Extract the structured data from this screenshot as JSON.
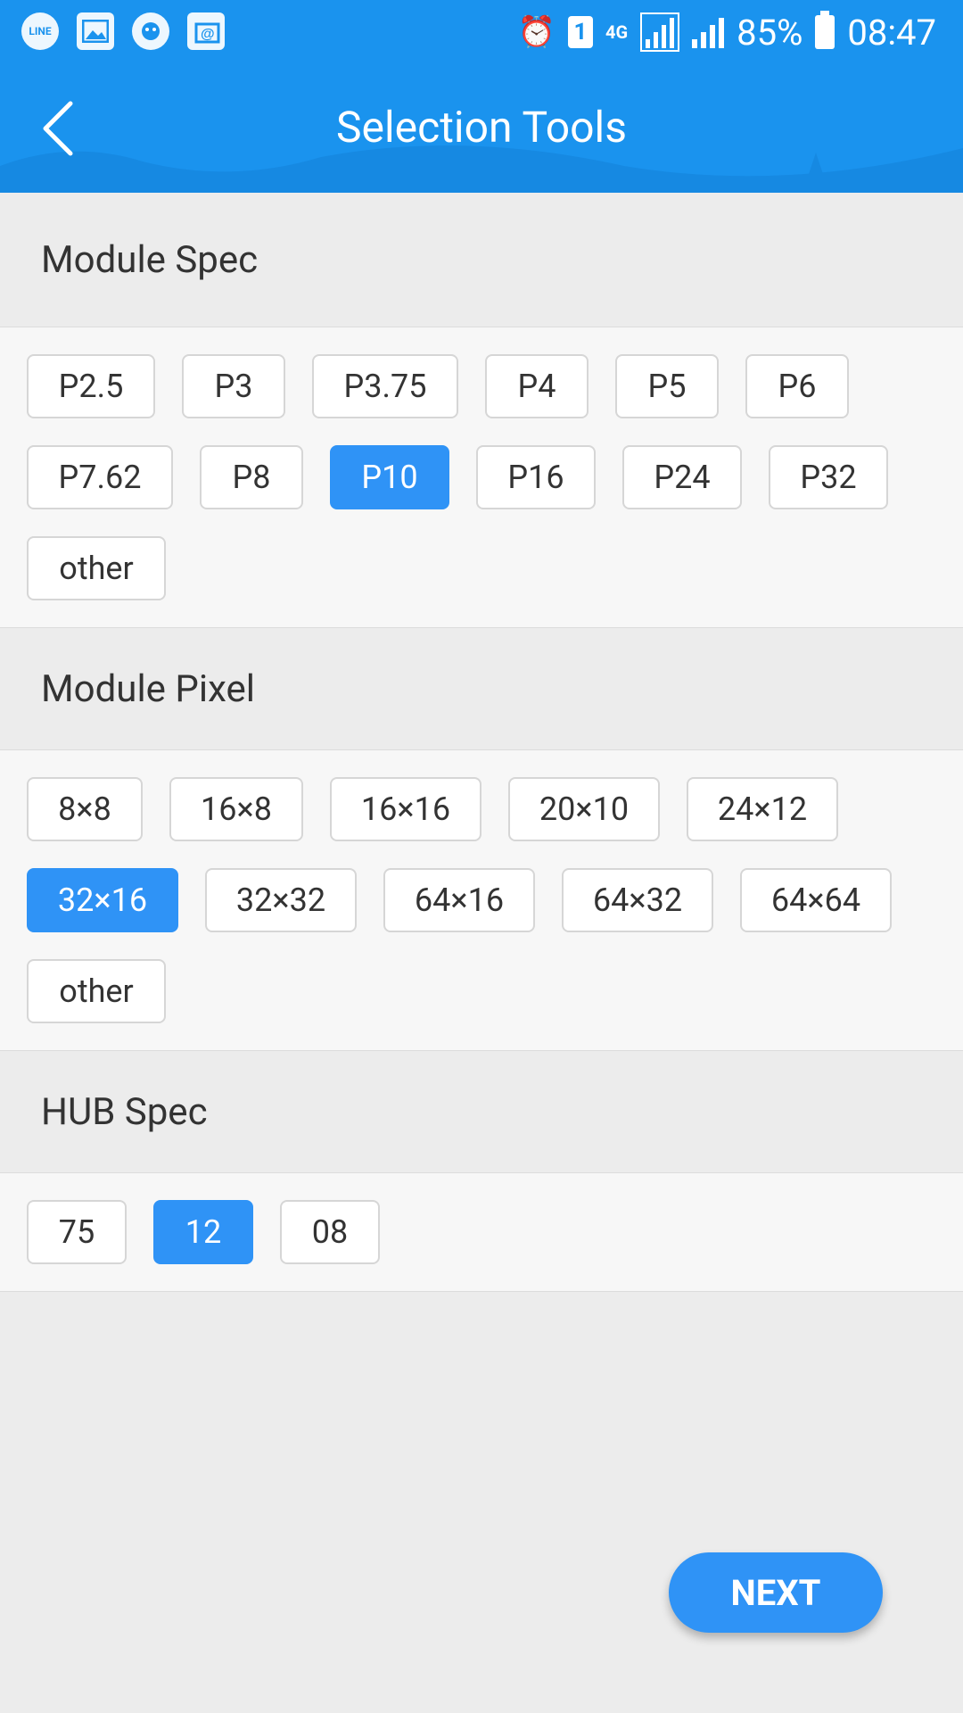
{
  "status_bar": {
    "line_icon_label": "LINE",
    "sim_number": "1",
    "network": "4G",
    "battery": "85%",
    "time": "08:47"
  },
  "app_bar": {
    "title": "Selection Tools"
  },
  "sections": {
    "module_spec": {
      "title": "Module Spec",
      "options": [
        "P2.5",
        "P3",
        "P3.75",
        "P4",
        "P5",
        "P6",
        "P7.62",
        "P8",
        "P10",
        "P16",
        "P24",
        "P32",
        "other"
      ],
      "selected": "P10"
    },
    "module_pixel": {
      "title": "Module Pixel",
      "options": [
        "8×8",
        "16×8",
        "16×16",
        "20×10",
        "24×12",
        "32×16",
        "32×32",
        "64×16",
        "64×32",
        "64×64",
        "other"
      ],
      "selected": "32×16"
    },
    "hub_spec": {
      "title": "HUB Spec",
      "options": [
        "75",
        "12",
        "08"
      ],
      "selected": "12"
    }
  },
  "next_button": {
    "label": "NEXT"
  },
  "colors": {
    "primary": "#1a93ee",
    "selected": "#2f93f6",
    "background": "#ececec"
  }
}
